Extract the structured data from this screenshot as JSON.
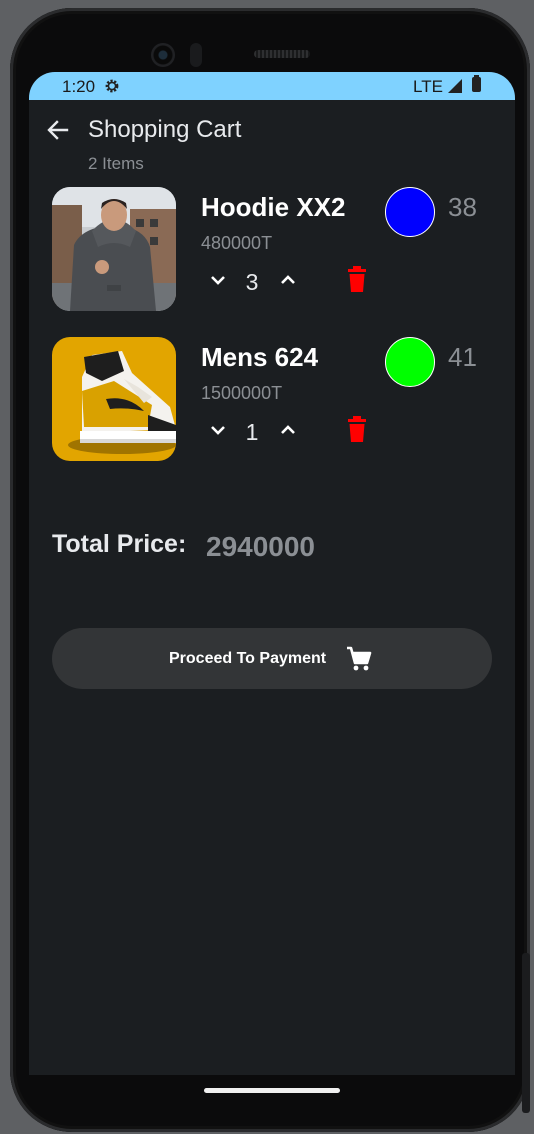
{
  "status_bar": {
    "time": "1:20",
    "network": "LTE",
    "background_color": "#7fd2ff",
    "settings_icon": "gear-icon",
    "signal_icon": "signal-icon",
    "battery_icon": "battery-icon"
  },
  "header": {
    "back_icon": "arrow-left-icon",
    "title": "Shopping Cart",
    "subtitle": "2 Items"
  },
  "cart": {
    "items": [
      {
        "name": "Hoodie XX2",
        "price": "480000T",
        "quantity": "3",
        "color": "#0000ff",
        "size": "38",
        "image": "grey hoodie photo"
      },
      {
        "name": "Mens 624",
        "price": "1500000T",
        "quantity": "1",
        "color": "#00ff00",
        "size": "41",
        "image": "yellow sneaker photo"
      }
    ],
    "decrement_icon": "chevron-down-icon",
    "increment_icon": "chevron-up-icon",
    "delete_icon": "trash-icon",
    "delete_color": "#ff0000"
  },
  "total": {
    "label": "Total Price:",
    "value": "2940000"
  },
  "payment_button": {
    "label": "Proceed To Payment",
    "icon": "cart-icon"
  },
  "theme": {
    "background": "#1b1e21",
    "text_primary": "#ffffff",
    "text_secondary": "#8b8f94",
    "button_bg": "#333537"
  }
}
